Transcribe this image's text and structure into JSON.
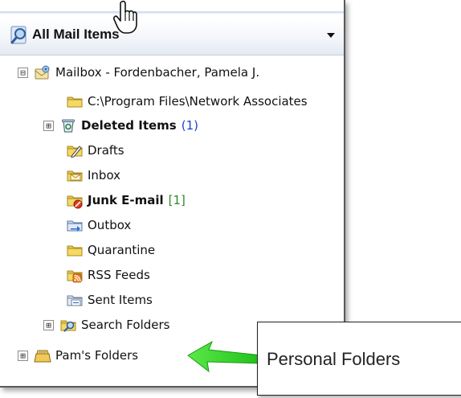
{
  "header": {
    "title": "All Mail Items",
    "icon": "search-folder-icon",
    "dropdown_icon": "dropdown-arrow-icon"
  },
  "tree": {
    "mailbox": {
      "label": "Mailbox - Fordenbacher, Pamela J.",
      "icon": "mailbox-icon",
      "toggle": "⊟"
    },
    "items": [
      {
        "key": "program-files",
        "label": "C:\\Program Files\\Network Associates",
        "icon": "folder-icon",
        "bold": false,
        "count": ""
      },
      {
        "key": "deleted-items",
        "label": "Deleted Items",
        "icon": "deleted-items-icon",
        "bold": true,
        "count": "(1)",
        "toggle": "⊞"
      },
      {
        "key": "drafts",
        "label": "Drafts",
        "icon": "drafts-icon",
        "bold": false,
        "count": ""
      },
      {
        "key": "inbox",
        "label": "Inbox",
        "icon": "inbox-icon",
        "bold": false,
        "count": ""
      },
      {
        "key": "junk",
        "label": "Junk E-mail",
        "icon": "junk-email-icon",
        "bold": true,
        "count": "[1]"
      },
      {
        "key": "outbox",
        "label": "Outbox",
        "icon": "outbox-icon",
        "bold": false,
        "count": ""
      },
      {
        "key": "quarantine",
        "label": "Quarantine",
        "icon": "folder-icon",
        "bold": false,
        "count": ""
      },
      {
        "key": "rss",
        "label": "RSS Feeds",
        "icon": "rss-feeds-icon",
        "bold": false,
        "count": ""
      },
      {
        "key": "sent",
        "label": "Sent Items",
        "icon": "sent-items-icon",
        "bold": false,
        "count": ""
      },
      {
        "key": "search",
        "label": "Search Folders",
        "icon": "search-folders-icon",
        "bold": false,
        "count": "",
        "toggle": "⊞"
      }
    ],
    "pams_folders": {
      "label": "Pam's Folders",
      "icon": "personal-folders-icon",
      "toggle": "⊞"
    }
  },
  "callout": {
    "text": "Personal Folders"
  },
  "colors": {
    "count_blue": "#1f3fd0",
    "count_green": "#2a8a2a",
    "arrow_green": "#39d62a"
  }
}
